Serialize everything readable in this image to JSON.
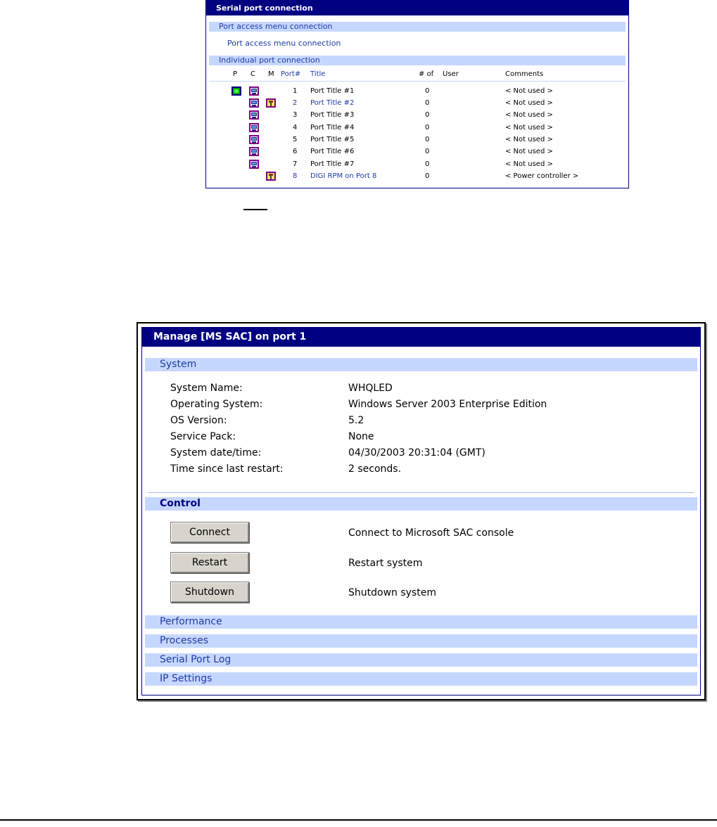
{
  "serial_panel": {
    "title": "Serial port connection",
    "section_menu": "Port access menu connection",
    "menu_link": "Port access menu connection",
    "section_individual": "Individual port connection",
    "headers": {
      "p": "P",
      "c": "C",
      "m": "M",
      "port": "Port#",
      "title": "Title",
      "count": "# of",
      "user": "User",
      "comments": "Comments"
    },
    "ports": [
      {
        "num": "1",
        "title": "Port Title #1",
        "count": "0",
        "comment": "< Not used >"
      },
      {
        "num": "2",
        "title": "Port Title #2",
        "count": "0",
        "comment": "< Not used >"
      },
      {
        "num": "3",
        "title": "Port Title #3",
        "count": "0",
        "comment": "< Not used >"
      },
      {
        "num": "4",
        "title": "Port Title #4",
        "count": "0",
        "comment": "< Not used >"
      },
      {
        "num": "5",
        "title": "Port Title #5",
        "count": "0",
        "comment": "< Not used >"
      },
      {
        "num": "6",
        "title": "Port Title #6",
        "count": "0",
        "comment": "< Not used >"
      },
      {
        "num": "7",
        "title": "Port Title #7",
        "count": "0",
        "comment": "< Not used >"
      },
      {
        "num": "8",
        "title": "DIGI RPM on Port 8",
        "count": "0",
        "comment": "< Power controller >"
      }
    ]
  },
  "manage_panel": {
    "title": "Manage [MS SAC] on port 1",
    "system_section": "System",
    "system": [
      {
        "label": "System Name:",
        "value": "WHQLED"
      },
      {
        "label": "Operating System:",
        "value": "Windows Server 2003 Enterprise Edition"
      },
      {
        "label": "OS Version:",
        "value": "5.2"
      },
      {
        "label": "Service Pack:",
        "value": "None"
      },
      {
        "label": "System date/time:",
        "value": "04/30/2003 20:31:04 (GMT)"
      },
      {
        "label": "Time since last restart:",
        "value": "2 seconds."
      }
    ],
    "control_section": "Control",
    "controls": [
      {
        "button": "Connect",
        "description": "Connect to Microsoft SAC console"
      },
      {
        "button": "Restart",
        "description": "Restart system"
      },
      {
        "button": "Shutdown",
        "description": "Shutdown system"
      }
    ],
    "sections": [
      "Performance",
      "Processes",
      "Serial Port Log",
      "IP Settings"
    ]
  }
}
